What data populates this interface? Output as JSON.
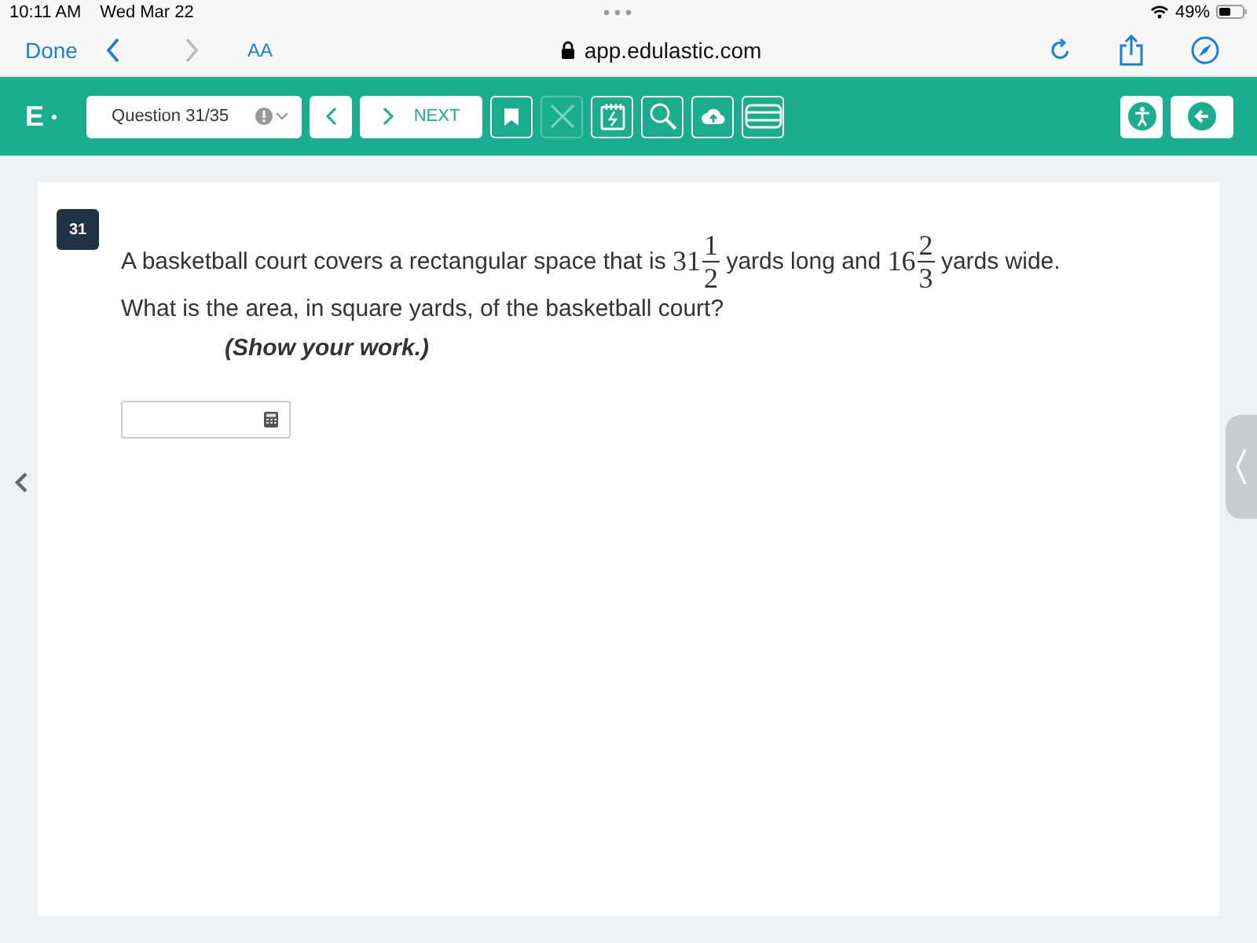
{
  "status_bar": {
    "time": "10:11 AM",
    "date": "Wed Mar 22",
    "battery": "49%"
  },
  "browser": {
    "done": "Done",
    "text_size": "AA",
    "url": "app.edulastic.com"
  },
  "toolbar": {
    "logo": "E",
    "question_select": "Question 31/35",
    "next": "NEXT"
  },
  "question": {
    "number": "31",
    "parts": [
      {
        "kind": "text",
        "text": "A basketball court covers a rectangular space that is "
      },
      {
        "kind": "mixed",
        "whole": "31",
        "num": "1",
        "den": "2"
      },
      {
        "kind": "text",
        "text": " yards long and "
      },
      {
        "kind": "mixed",
        "whole": "16",
        "num": "2",
        "den": "3"
      },
      {
        "kind": "text",
        "text": " yards wide."
      }
    ],
    "line2": "What is the area, in square yards, of the basketball court?",
    "note": "(Show your work.)"
  }
}
